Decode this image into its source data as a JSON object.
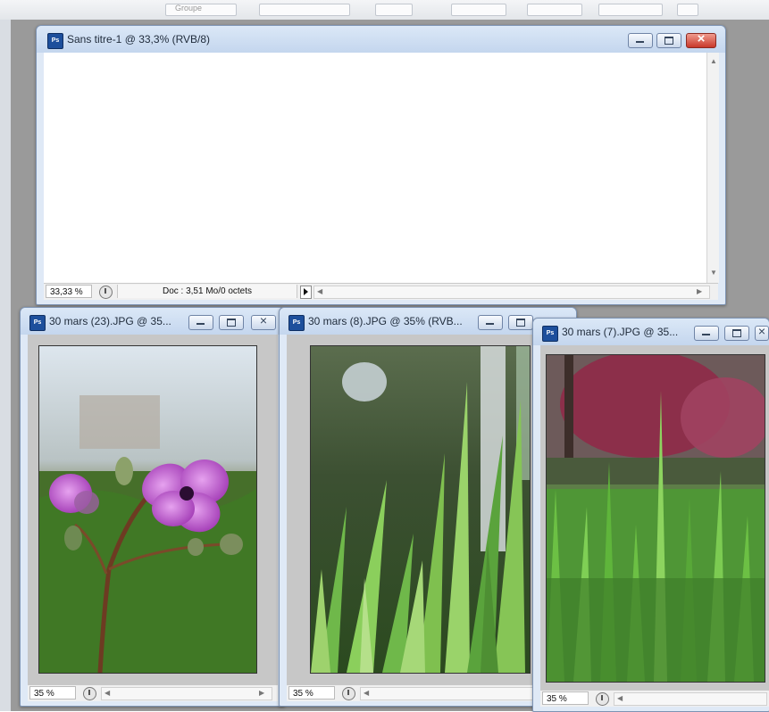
{
  "toolbar": {
    "partial_label": "Groupe"
  },
  "windows": [
    {
      "title": "Sans titre-1 @ 33,3% (RVB/8)",
      "zoom": "33,33 %",
      "doc_info": "Doc : 3,51 Mo/0 octets"
    },
    {
      "title": "30 mars (23).JPG @ 35...",
      "zoom": "35 %"
    },
    {
      "title": "30 mars (8).JPG @ 35% (RVB...",
      "zoom": "35 %"
    },
    {
      "title": "30 mars (7).JPG @ 35...",
      "zoom": "35 %"
    }
  ],
  "icons": [
    "photoshop-doc-icon",
    "minimize-icon",
    "maximize-icon",
    "close-icon",
    "info-icon",
    "menu-arrow-icon",
    "scroll-arrow-icon"
  ],
  "colors": {
    "title_bar": "#c4d6ee",
    "workspace": "#9a9a9a",
    "close_red": "#c8382a"
  }
}
